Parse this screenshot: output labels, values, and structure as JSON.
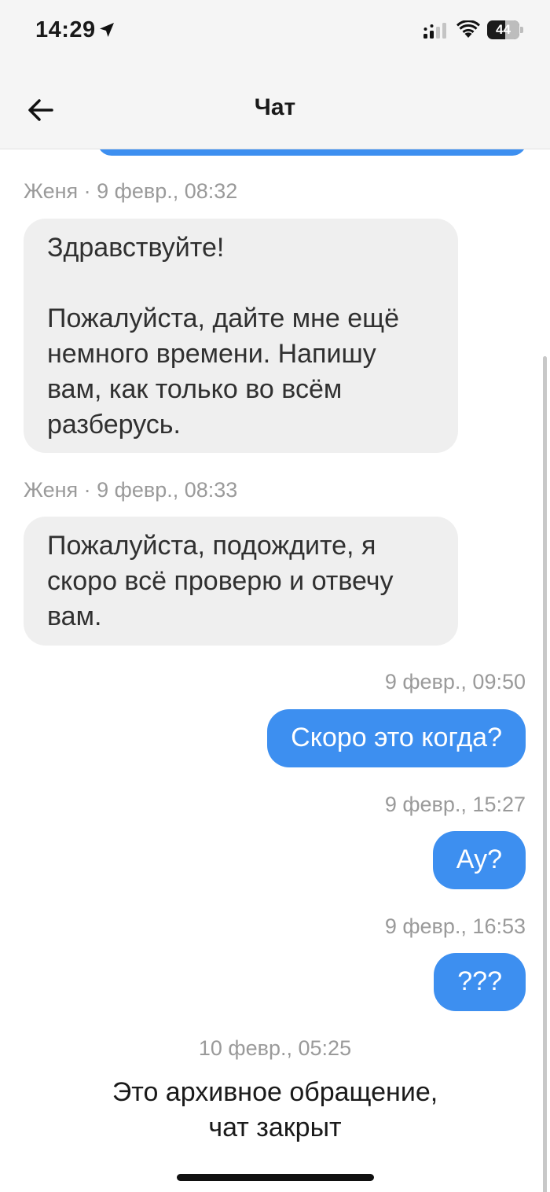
{
  "status_bar": {
    "time": "14:29",
    "battery": "44",
    "icons": [
      "location-arrow-icon",
      "cellular-signal-icon",
      "wifi-icon",
      "battery-icon"
    ]
  },
  "header": {
    "title": "Чат",
    "back_icon": "arrow-left-icon"
  },
  "messages": [
    {
      "side": "in",
      "meta": "Женя · 9 февр., 08:32",
      "text": "Здравствуйте!\n\nПожалуйста, дайте мне ещё немного времени. Напишу вам, как только во всём разберусь."
    },
    {
      "side": "in",
      "meta": "Женя · 9 февр., 08:33",
      "text": "Пожалуйста, подождите, я скоро всё проверю и отвечу вам."
    },
    {
      "side": "out",
      "meta": "9 февр., 09:50",
      "text": "Скоро это когда?"
    },
    {
      "side": "out",
      "meta": "9 февр., 15:27",
      "text": "Ау?"
    },
    {
      "side": "out",
      "meta": "9 февр., 16:53",
      "text": "???"
    }
  ],
  "footer": {
    "date": "10 февр., 05:25",
    "closed_text": "Это архивное обращение,\nчат закрыт"
  },
  "colors": {
    "outgoing_bubble": "#3d8ff0",
    "incoming_bubble": "#efefef",
    "meta_text": "#9a9a9a",
    "bars_background": "#f5f5f5"
  }
}
